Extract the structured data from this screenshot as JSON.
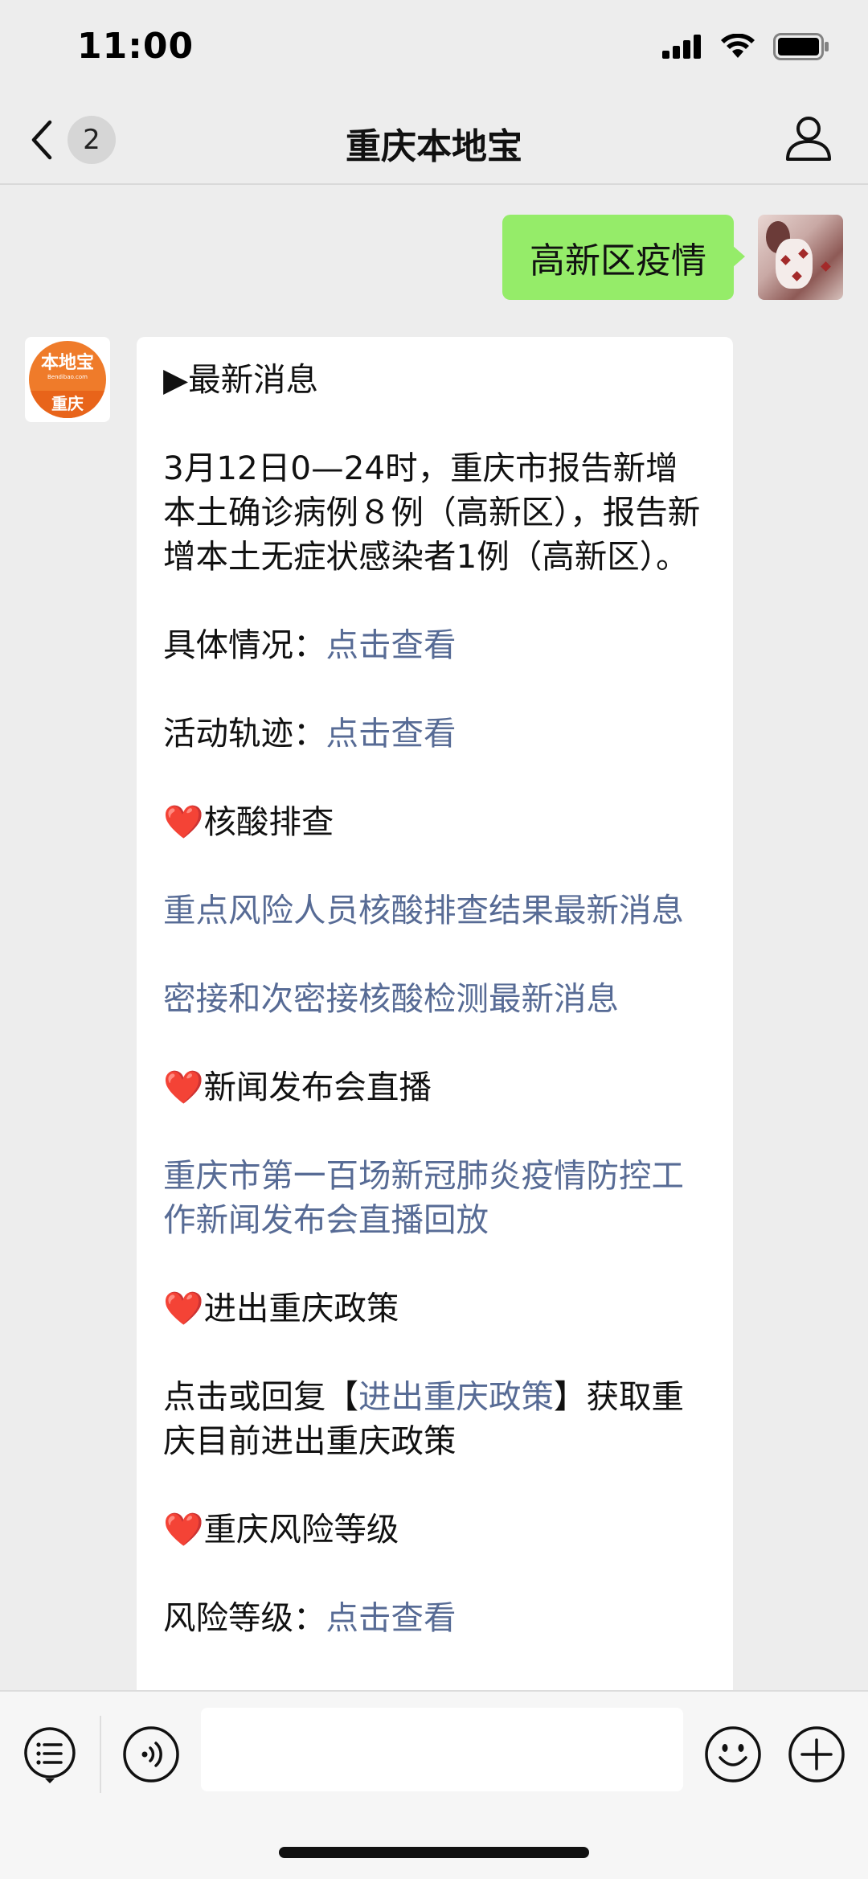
{
  "status_bar": {
    "time": "11:00"
  },
  "nav": {
    "title": "重庆本地宝",
    "unread_count": "2"
  },
  "messages": {
    "sent": "高新区疫情",
    "bot_logo": {
      "top": "本地宝",
      "url": "Bendibao.com",
      "bottom": "重庆"
    },
    "received": {
      "headline": "▶最新消息",
      "summary": "3月12日0—24时，重庆市报告新增本土确诊病例８例（高新区），报告新增本土无症状感染者1例（高新区）。",
      "detail_label": "具体情况：",
      "detail_link": "点击查看",
      "track_label": "活动轨迹：",
      "track_link": "点击查看",
      "heart": "❤️",
      "section_nucleic": "核酸排查",
      "link_key_risk": "重点风险人员核酸排查结果最新消息",
      "link_close_contact": "密接和次密接核酸检测最新消息",
      "section_press": "新闻发布会直播",
      "link_press": "重庆市第一百场新冠肺炎疫情防控工作新闻发布会直播回放",
      "section_policy": "进出重庆政策",
      "policy_prefix": "点击或回复【",
      "policy_link": "进出重庆政策",
      "policy_suffix": "】获取重庆目前进出重庆政策",
      "section_risk": "重庆风险等级",
      "risk_label": "风险等级：",
      "risk_link": "点击查看"
    }
  },
  "input_bar": {
    "text_value": ""
  },
  "colors": {
    "sent_bubble": "#95ec69",
    "link": "#576b95",
    "heart": "#e22828",
    "brand_orange": "#ef7b2a"
  },
  "icons": [
    "back-icon",
    "profile-icon",
    "menu-list-icon",
    "voice-icon",
    "emoji-icon",
    "plus-icon",
    "signal-icon",
    "wifi-icon",
    "battery-icon"
  ]
}
